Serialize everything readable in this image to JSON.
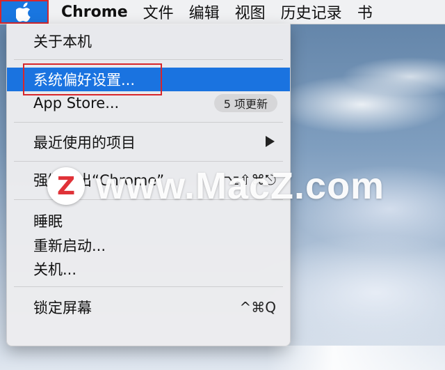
{
  "menubar": {
    "app_name": "Chrome",
    "items": [
      "文件",
      "编辑",
      "视图",
      "历史记录",
      "书"
    ]
  },
  "apple_menu": {
    "about": "关于本机",
    "system_prefs": "系统偏好设置...",
    "app_store": "App Store...",
    "app_store_badge": "5 项更新",
    "recent_items": "最近使用的项目",
    "force_quit": "强制退出“Chrome”",
    "force_quit_shortcut": "⌥⇧⌘⎋",
    "sleep": "睡眠",
    "restart": "重新启动...",
    "shutdown": "关机...",
    "lock_screen": "锁定屏幕",
    "lock_shortcut": "^⌘Q"
  },
  "watermark": {
    "logo_letter": "Z",
    "text": "www.MacZ.com"
  },
  "colors": {
    "highlight": "#1a73e0",
    "annotation_border": "#d8262b",
    "watermark_logo": "#e03238"
  }
}
